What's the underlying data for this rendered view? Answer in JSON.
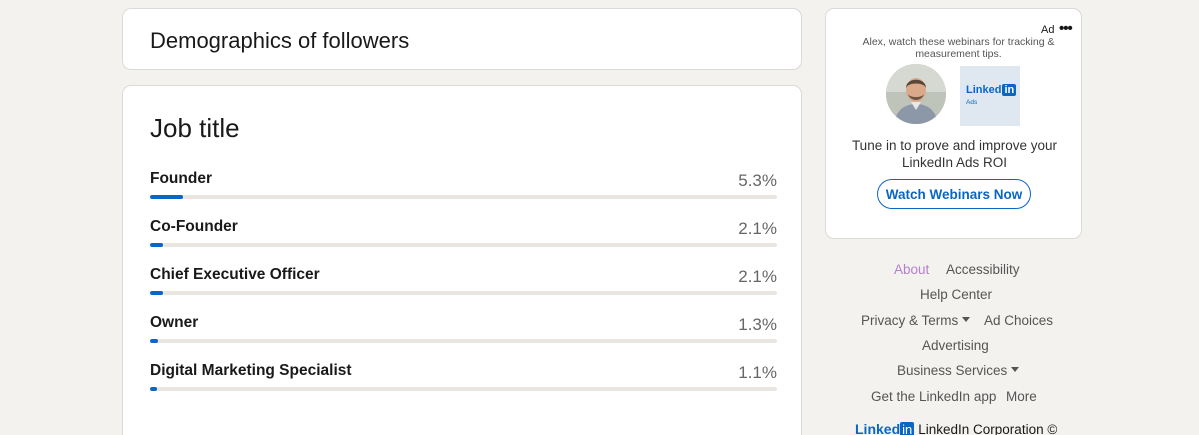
{
  "demographics": {
    "title": "Demographics of followers"
  },
  "job_title_section": {
    "title": "Job title",
    "rows": [
      {
        "label": "Founder",
        "percent_text": "5.3%",
        "percent": 5.3
      },
      {
        "label": "Co-Founder",
        "percent_text": "2.1%",
        "percent": 2.1
      },
      {
        "label": "Chief Executive Officer",
        "percent_text": "2.1%",
        "percent": 2.1
      },
      {
        "label": "Owner",
        "percent_text": "1.3%",
        "percent": 1.3
      },
      {
        "label": "Digital Marketing Specialist",
        "percent_text": "1.1%",
        "percent": 1.1
      }
    ]
  },
  "ad": {
    "label": "Ad",
    "more_icon": "•••",
    "tagline": "Alex, watch these webinars for tracking & measurement tips.",
    "logo_word": "Linked",
    "logo_in": "in",
    "logo_sub": "Ads",
    "body": "Tune in to prove and improve your LinkedIn Ads ROI",
    "cta": "Watch Webinars Now"
  },
  "footer": {
    "about": "About",
    "accessibility": "Accessibility",
    "help_center": "Help Center",
    "privacy_terms": "Privacy & Terms",
    "ad_choices": "Ad Choices",
    "advertising": "Advertising",
    "business_services": "Business Services",
    "get_app": "Get the LinkedIn app",
    "more": "More",
    "brand_word": "Linked",
    "brand_in": "in",
    "corporation": "LinkedIn Corporation ©"
  },
  "colors": {
    "accent": "#0a66c2",
    "visited_link": "#b57fd0",
    "bar_track": "#e9e6e1"
  }
}
